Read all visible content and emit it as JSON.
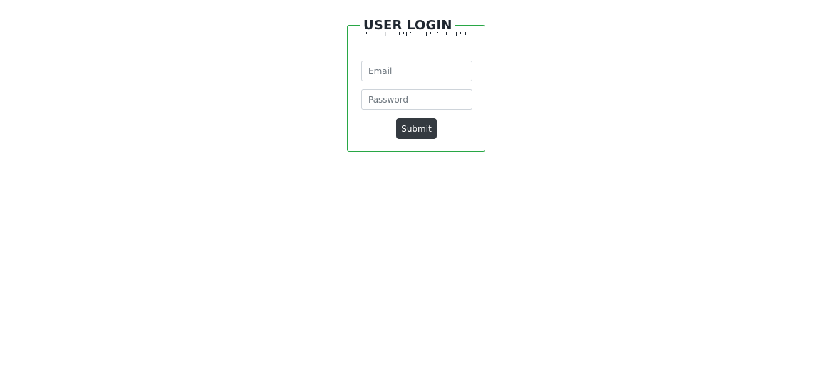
{
  "login": {
    "title": "USER LOGIN",
    "email_placeholder": "Email",
    "email_value": "",
    "password_placeholder": "Password",
    "password_value": "",
    "submit_label": "Submit"
  },
  "colors": {
    "border": "#28a745",
    "title": "#1f2730",
    "button_bg": "#343a40",
    "button_text": "#ffffff"
  }
}
